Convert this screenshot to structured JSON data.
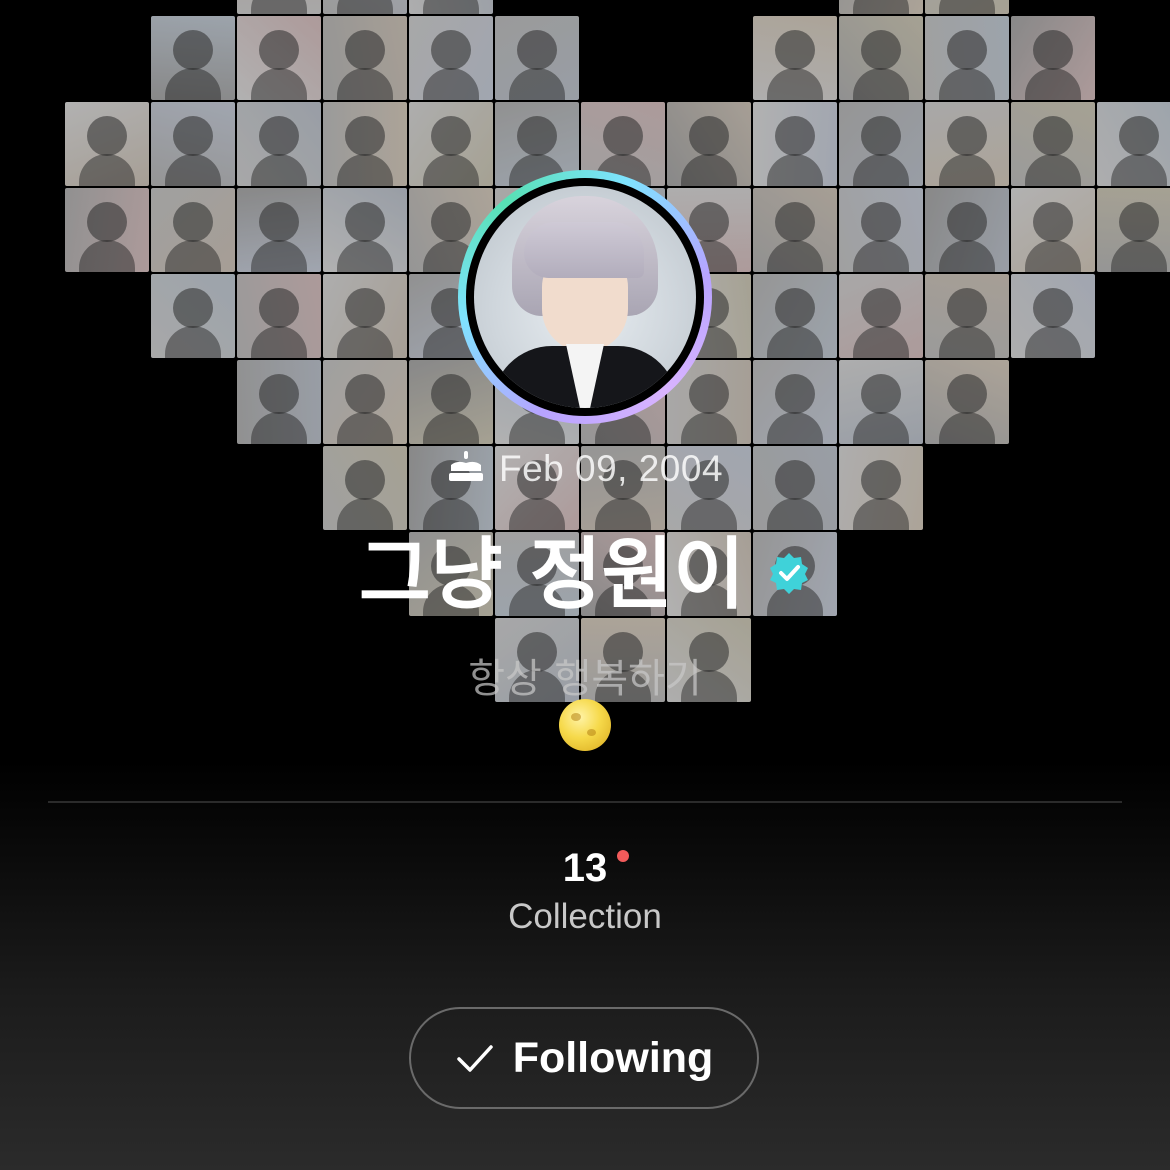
{
  "profile": {
    "birthday": "Feb 09, 2004",
    "name": "그냥 정원이",
    "bio": "항상 행복하기",
    "bio_emoji_icon": "full-moon-icon",
    "verified_icon": "verified-badge-icon"
  },
  "stats": {
    "collection_count": "13",
    "collection_label": "Collection",
    "has_new_indicator": true
  },
  "follow_button": {
    "label": "Following",
    "icon": "checkmark-icon"
  },
  "colors": {
    "verified": "#3fd2d9",
    "new_dot": "#f25b5b",
    "ring_gradient": [
      "#b7a3ff",
      "#7fe3ff",
      "#57e0b3"
    ]
  }
}
